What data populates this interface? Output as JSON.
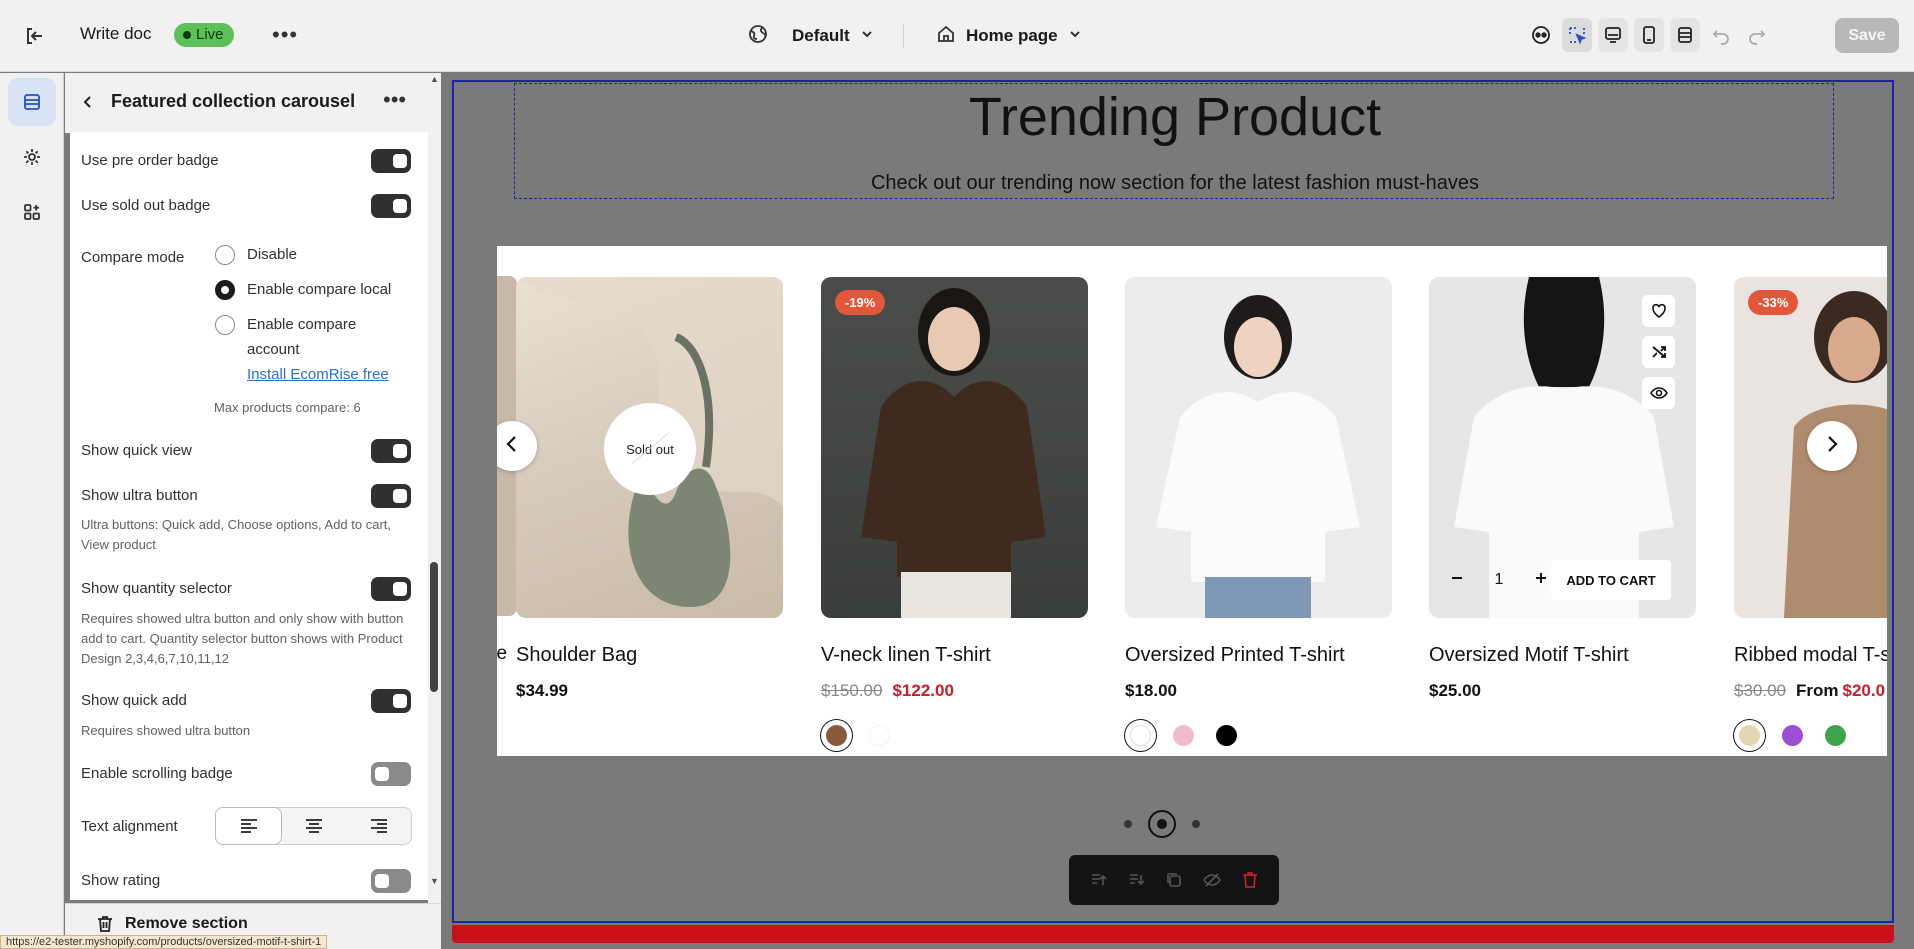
{
  "topbar": {
    "title": "Write doc",
    "status": "Live",
    "more": "•••",
    "theme": "Default",
    "page": "Home page",
    "save": "Save"
  },
  "panel": {
    "title": "Featured collection carousel",
    "more": "•••",
    "settings": {
      "pre_order_badge": "Use pre order badge",
      "sold_out_badge": "Use sold out badge",
      "compare_mode": "Compare mode",
      "compare_options": [
        "Disable",
        "Enable compare local",
        "Enable compare account"
      ],
      "compare_selected": "Enable compare local",
      "install_link": "Install EcomRise free",
      "max_compare": "Max products compare: 6",
      "quick_view": "Show quick view",
      "ultra_button": "Show ultra button",
      "ultra_hint": "Ultra buttons: Quick add, Choose options, Add to cart, View product",
      "quantity_selector": "Show quantity selector",
      "quantity_hint": "Requires showed ultra button and only show with button add to cart. Quantity selector button shows with Product Design 2,3,4,6,7,10,11,12",
      "quick_add": "Show quick add",
      "quick_add_hint": "Requires showed ultra button",
      "scrolling_badge": "Enable scrolling badge",
      "text_alignment": "Text alignment",
      "text_alignment_selected": "left",
      "show_rating": "Show rating"
    },
    "remove_section": "Remove section"
  },
  "status_url": "https://e2-tester.myshopify.com/products/oversized-motif-t-shirt-1",
  "preview": {
    "heading": "Trending Product",
    "subheading": "Check out our trending now section for the latest fashion must-haves",
    "edge_text": "se",
    "products": [
      {
        "name": "Shoulder Bag",
        "price": "$34.99",
        "sold_out": "Sold out"
      },
      {
        "name": "V-neck linen T-shirt",
        "old_price": "$150.00",
        "price": "$122.00",
        "badge": "-19%",
        "swatches": [
          "#8a5a3c",
          "#ffffff"
        ]
      },
      {
        "name": "Oversized Printed T-shirt",
        "price": "$18.00",
        "swatches": [
          "#ffffff",
          "#f0bccb",
          "#000000"
        ]
      },
      {
        "name": "Oversized Motif T-shirt",
        "price": "$25.00",
        "qty": "1",
        "add_to_cart": "ADD TO CART"
      },
      {
        "name": "Ribbed modal T-s",
        "old_price": "$30.00",
        "from": "From",
        "price": "$20.0",
        "badge": "-33%",
        "swatches": [
          "#e2d6b4",
          "#9b4fd1",
          "#3fa34d"
        ]
      }
    ],
    "pagination": {
      "pages": 3,
      "current": 2
    }
  },
  "colors": {
    "accent": "#1d22a8",
    "live": "#5ec05a",
    "sale": "#c2202a",
    "badge": "#e1573b"
  }
}
